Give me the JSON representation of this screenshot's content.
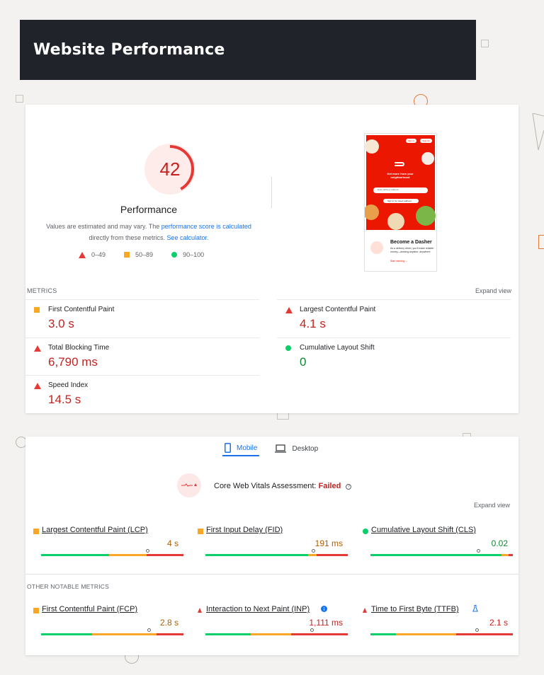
{
  "header": {
    "title": "Website Performance"
  },
  "summary": {
    "score": "42",
    "score_fraction": 0.42,
    "label": "Performance",
    "note_prefix": "Values are estimated and may vary. The",
    "note_link": "performance score is calculated",
    "note_middle": "directly from these metrics.",
    "note_calc_link": "See calculator.",
    "legend": [
      {
        "range": "0–49",
        "shape": "triangle",
        "color": "#e53935"
      },
      {
        "range": "50–89",
        "shape": "square",
        "color": "#f9a825"
      },
      {
        "range": "90–100",
        "shape": "circle",
        "color": "#0cce6b"
      }
    ]
  },
  "screenshot": {
    "sign_in": "Sign in",
    "sign_up": "Sign Up",
    "tagline": "Get more from your neighborhood",
    "search_placeholder": "Enter delivery address",
    "saved_address_btn": "Sign in for saved address",
    "dasher_title": "Become a Dasher",
    "dasher_body": "As a delivery driver, you'll make reliable money—working anytime, anywhere.",
    "dasher_link": "Start earning →"
  },
  "metrics": {
    "title": "METRICS",
    "expand": "Expand view",
    "items": [
      {
        "label": "First Contentful Paint",
        "value": "3.0 s",
        "status": "average"
      },
      {
        "label": "Largest Contentful Paint",
        "value": "4.1 s",
        "status": "fail"
      },
      {
        "label": "Total Blocking Time",
        "value": "6,790 ms",
        "status": "fail"
      },
      {
        "label": "Cumulative Layout Shift",
        "value": "0",
        "status": "pass"
      },
      {
        "label": "Speed Index",
        "value": "14.5 s",
        "status": "fail"
      }
    ]
  },
  "field": {
    "tabs": [
      {
        "label": "Mobile",
        "icon": "phone-icon",
        "active": true
      },
      {
        "label": "Desktop",
        "icon": "laptop-icon",
        "active": false
      }
    ],
    "cwv_prefix": "Core Web Vitals Assessment:",
    "cwv_status": "Failed",
    "expand": "Expand view",
    "core": [
      {
        "label": "Largest Contentful Paint (LCP)",
        "value": "4 s",
        "status": "average",
        "dist": [
          0.48,
          0.26,
          0.26
        ],
        "pin": 0.75
      },
      {
        "label": "First Input Delay (FID)",
        "value": "191 ms",
        "status": "average",
        "dist": [
          0.72,
          0.06,
          0.22
        ],
        "pin": 0.76
      },
      {
        "label": "Cumulative Layout Shift (CLS)",
        "value": "0.02",
        "status": "pass",
        "dist": [
          0.92,
          0.05,
          0.03
        ],
        "pin": 0.76
      }
    ],
    "other_title": "OTHER NOTABLE METRICS",
    "other": [
      {
        "label": "First Contentful Paint (FCP)",
        "value": "2.8 s",
        "status": "average",
        "dist": [
          0.36,
          0.45,
          0.19
        ],
        "pin": 0.76
      },
      {
        "label": "Interaction to Next Paint (INP)",
        "value": "1,111 ms",
        "status": "fail",
        "dist": [
          0.32,
          0.28,
          0.4
        ],
        "pin": 0.75,
        "badge": "info-icon"
      },
      {
        "label": "Time to First Byte (TTFB)",
        "value": "2.1 s",
        "status": "fail",
        "dist": [
          0.18,
          0.42,
          0.4
        ],
        "pin": 0.75,
        "badge": "flask-icon"
      }
    ]
  },
  "colors": {
    "pass": "#0cce6b",
    "average": "#f9a825",
    "fail": "#e53935",
    "accent": "#1a73e8"
  }
}
